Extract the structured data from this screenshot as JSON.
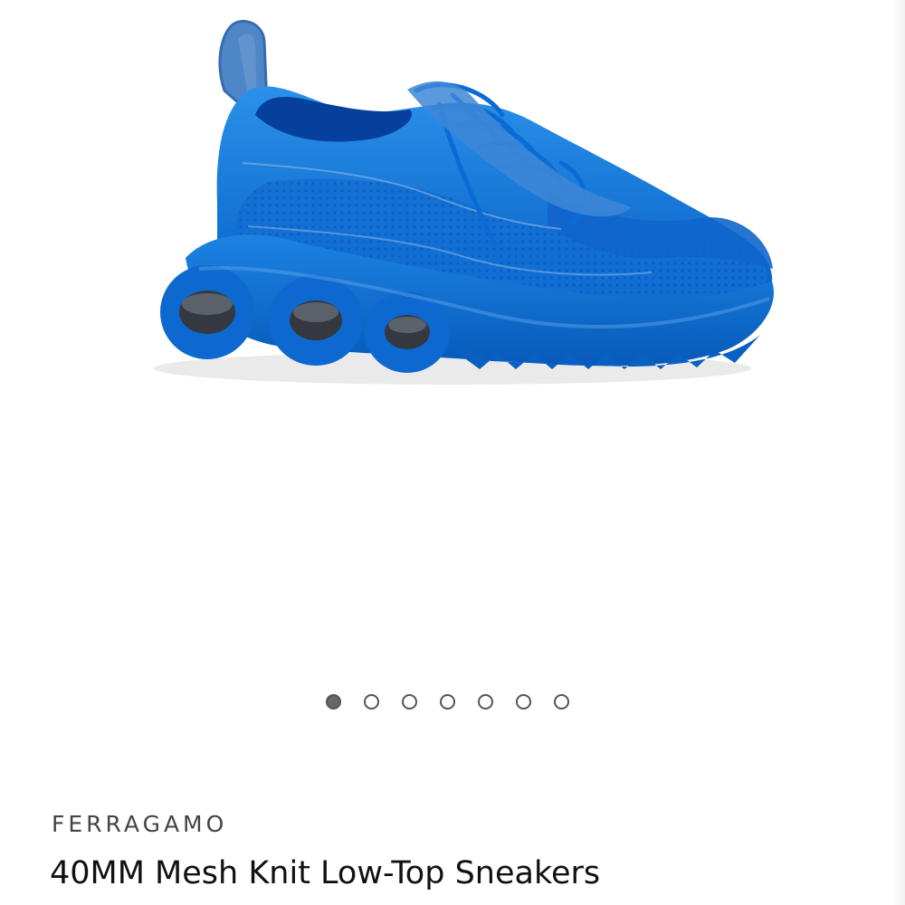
{
  "product": {
    "brand": "FERRAGAMO",
    "title": "40MM Mesh Knit Low-Top Sneakers",
    "image_icon": "blue-mesh-sneaker-image",
    "primary_color": "#0f6ed8"
  },
  "gallery": {
    "active_index": 0,
    "dot_count": 7
  }
}
